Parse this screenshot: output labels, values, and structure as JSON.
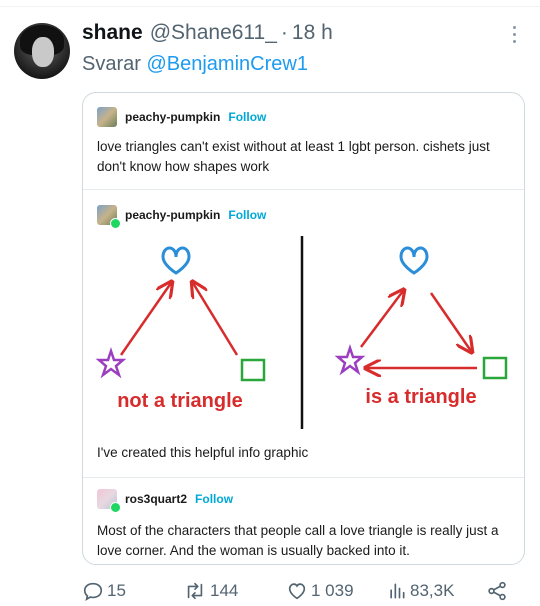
{
  "tweet": {
    "display_name": "shane",
    "handle": "@Shane611_",
    "separator": "·",
    "time": "18 h",
    "reply_prefix": "Svarar",
    "reply_to": "@BenjaminCrew1"
  },
  "tumblr_post": {
    "posts": [
      {
        "username": "peachy-pumpkin",
        "follow_label": "Follow",
        "text": "love triangles can't exist without at least 1 lgbt person. cishets just don't know how shapes work"
      },
      {
        "username": "peachy-pumpkin",
        "follow_label": "Follow",
        "caption": "I've created this helpful info graphic"
      },
      {
        "username": "ros3quart2",
        "follow_label": "Follow",
        "text": "Most of the characters that people call a love triangle is really just a love corner. And the woman is usually backed into it."
      }
    ],
    "graphic": {
      "left_label": "not a triangle",
      "right_label": "is a triangle",
      "colors": {
        "heart": "#2a8fd8",
        "star": "#9b3fc0",
        "square": "#2aa63a",
        "arrow": "#d82c2c",
        "label": "#d82c2c"
      }
    }
  },
  "actions": {
    "replies": "15",
    "retweets": "144",
    "likes": "1 039",
    "views": "83,3K"
  }
}
